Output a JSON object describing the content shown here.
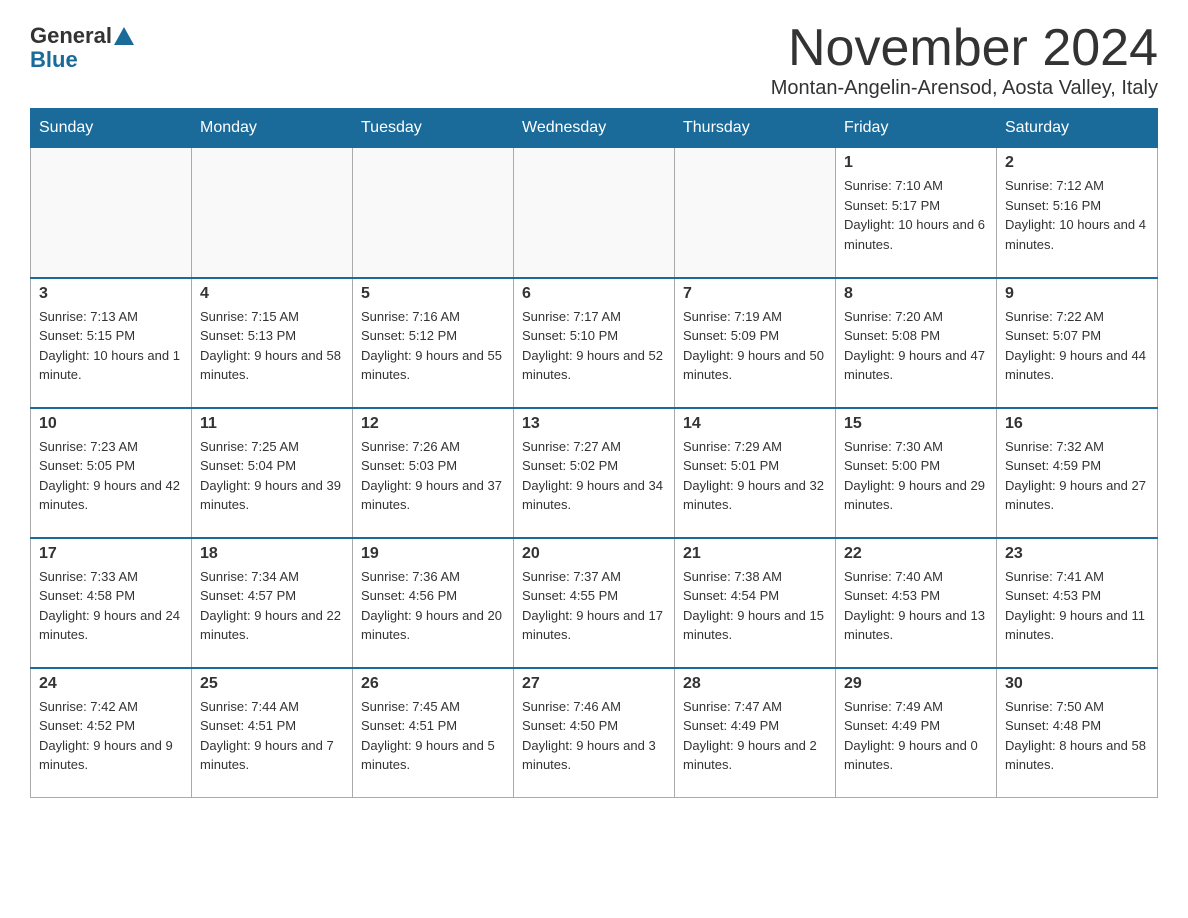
{
  "logo": {
    "general": "General",
    "blue": "Blue"
  },
  "title": "November 2024",
  "location": "Montan-Angelin-Arensod, Aosta Valley, Italy",
  "days_of_week": [
    "Sunday",
    "Monday",
    "Tuesday",
    "Wednesday",
    "Thursday",
    "Friday",
    "Saturday"
  ],
  "weeks": [
    [
      {
        "day": "",
        "info": ""
      },
      {
        "day": "",
        "info": ""
      },
      {
        "day": "",
        "info": ""
      },
      {
        "day": "",
        "info": ""
      },
      {
        "day": "",
        "info": ""
      },
      {
        "day": "1",
        "info": "Sunrise: 7:10 AM\nSunset: 5:17 PM\nDaylight: 10 hours and 6 minutes."
      },
      {
        "day": "2",
        "info": "Sunrise: 7:12 AM\nSunset: 5:16 PM\nDaylight: 10 hours and 4 minutes."
      }
    ],
    [
      {
        "day": "3",
        "info": "Sunrise: 7:13 AM\nSunset: 5:15 PM\nDaylight: 10 hours and 1 minute."
      },
      {
        "day": "4",
        "info": "Sunrise: 7:15 AM\nSunset: 5:13 PM\nDaylight: 9 hours and 58 minutes."
      },
      {
        "day": "5",
        "info": "Sunrise: 7:16 AM\nSunset: 5:12 PM\nDaylight: 9 hours and 55 minutes."
      },
      {
        "day": "6",
        "info": "Sunrise: 7:17 AM\nSunset: 5:10 PM\nDaylight: 9 hours and 52 minutes."
      },
      {
        "day": "7",
        "info": "Sunrise: 7:19 AM\nSunset: 5:09 PM\nDaylight: 9 hours and 50 minutes."
      },
      {
        "day": "8",
        "info": "Sunrise: 7:20 AM\nSunset: 5:08 PM\nDaylight: 9 hours and 47 minutes."
      },
      {
        "day": "9",
        "info": "Sunrise: 7:22 AM\nSunset: 5:07 PM\nDaylight: 9 hours and 44 minutes."
      }
    ],
    [
      {
        "day": "10",
        "info": "Sunrise: 7:23 AM\nSunset: 5:05 PM\nDaylight: 9 hours and 42 minutes."
      },
      {
        "day": "11",
        "info": "Sunrise: 7:25 AM\nSunset: 5:04 PM\nDaylight: 9 hours and 39 minutes."
      },
      {
        "day": "12",
        "info": "Sunrise: 7:26 AM\nSunset: 5:03 PM\nDaylight: 9 hours and 37 minutes."
      },
      {
        "day": "13",
        "info": "Sunrise: 7:27 AM\nSunset: 5:02 PM\nDaylight: 9 hours and 34 minutes."
      },
      {
        "day": "14",
        "info": "Sunrise: 7:29 AM\nSunset: 5:01 PM\nDaylight: 9 hours and 32 minutes."
      },
      {
        "day": "15",
        "info": "Sunrise: 7:30 AM\nSunset: 5:00 PM\nDaylight: 9 hours and 29 minutes."
      },
      {
        "day": "16",
        "info": "Sunrise: 7:32 AM\nSunset: 4:59 PM\nDaylight: 9 hours and 27 minutes."
      }
    ],
    [
      {
        "day": "17",
        "info": "Sunrise: 7:33 AM\nSunset: 4:58 PM\nDaylight: 9 hours and 24 minutes."
      },
      {
        "day": "18",
        "info": "Sunrise: 7:34 AM\nSunset: 4:57 PM\nDaylight: 9 hours and 22 minutes."
      },
      {
        "day": "19",
        "info": "Sunrise: 7:36 AM\nSunset: 4:56 PM\nDaylight: 9 hours and 20 minutes."
      },
      {
        "day": "20",
        "info": "Sunrise: 7:37 AM\nSunset: 4:55 PM\nDaylight: 9 hours and 17 minutes."
      },
      {
        "day": "21",
        "info": "Sunrise: 7:38 AM\nSunset: 4:54 PM\nDaylight: 9 hours and 15 minutes."
      },
      {
        "day": "22",
        "info": "Sunrise: 7:40 AM\nSunset: 4:53 PM\nDaylight: 9 hours and 13 minutes."
      },
      {
        "day": "23",
        "info": "Sunrise: 7:41 AM\nSunset: 4:53 PM\nDaylight: 9 hours and 11 minutes."
      }
    ],
    [
      {
        "day": "24",
        "info": "Sunrise: 7:42 AM\nSunset: 4:52 PM\nDaylight: 9 hours and 9 minutes."
      },
      {
        "day": "25",
        "info": "Sunrise: 7:44 AM\nSunset: 4:51 PM\nDaylight: 9 hours and 7 minutes."
      },
      {
        "day": "26",
        "info": "Sunrise: 7:45 AM\nSunset: 4:51 PM\nDaylight: 9 hours and 5 minutes."
      },
      {
        "day": "27",
        "info": "Sunrise: 7:46 AM\nSunset: 4:50 PM\nDaylight: 9 hours and 3 minutes."
      },
      {
        "day": "28",
        "info": "Sunrise: 7:47 AM\nSunset: 4:49 PM\nDaylight: 9 hours and 2 minutes."
      },
      {
        "day": "29",
        "info": "Sunrise: 7:49 AM\nSunset: 4:49 PM\nDaylight: 9 hours and 0 minutes."
      },
      {
        "day": "30",
        "info": "Sunrise: 7:50 AM\nSunset: 4:48 PM\nDaylight: 8 hours and 58 minutes."
      }
    ]
  ]
}
